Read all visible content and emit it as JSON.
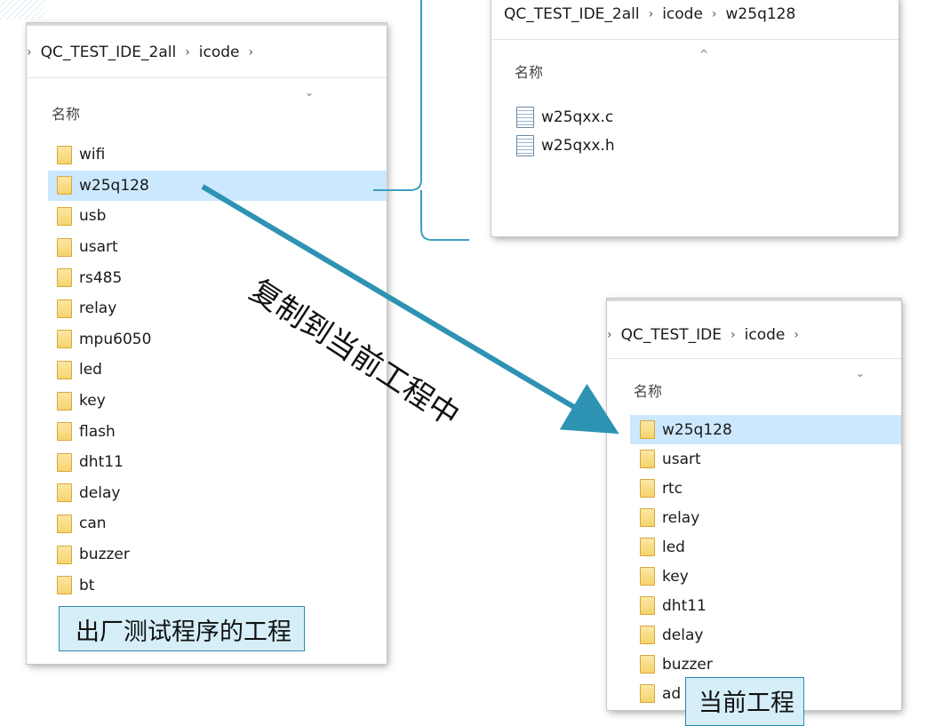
{
  "left_window": {
    "breadcrumb": [
      "QC_TEST_IDE_2all",
      "icode"
    ],
    "crumb_sep": "›",
    "column_header": "名称",
    "sort_icon": "⌄",
    "selected_index": 1,
    "folders": [
      "wifi",
      "w25q128",
      "usb",
      "usart",
      "rs485",
      "relay",
      "mpu6050",
      "led",
      "key",
      "flash",
      "dht11",
      "delay",
      "can",
      "buzzer",
      "bt"
    ]
  },
  "top_window": {
    "breadcrumb": [
      "QC_TEST_IDE_2all",
      "icode",
      "w25q128"
    ],
    "crumb_sep": "›",
    "column_header": "名称",
    "sort_icon": "^",
    "files": [
      "w25qxx.c",
      "w25qxx.h"
    ]
  },
  "bottom_window": {
    "breadcrumb": [
      "QC_TEST_IDE",
      "icode"
    ],
    "crumb_sep": "›",
    "column_header": "名称",
    "sort_icon": "⌄",
    "selected_index": 0,
    "folders": [
      "w25q128",
      "usart",
      "rtc",
      "relay",
      "led",
      "key",
      "dht11",
      "delay",
      "buzzer",
      "ad"
    ]
  },
  "annotations": {
    "copy_label": "复制到当前工程中",
    "left_caption": "出厂测试程序的工程",
    "bottom_caption": "当前工程"
  },
  "colors": {
    "arrow": "#2e93b3",
    "bracket": "#3aa0c2",
    "selection": "#cce8ff",
    "callout_fill": "#d5eef8",
    "callout_border": "#2b8bb0"
  }
}
